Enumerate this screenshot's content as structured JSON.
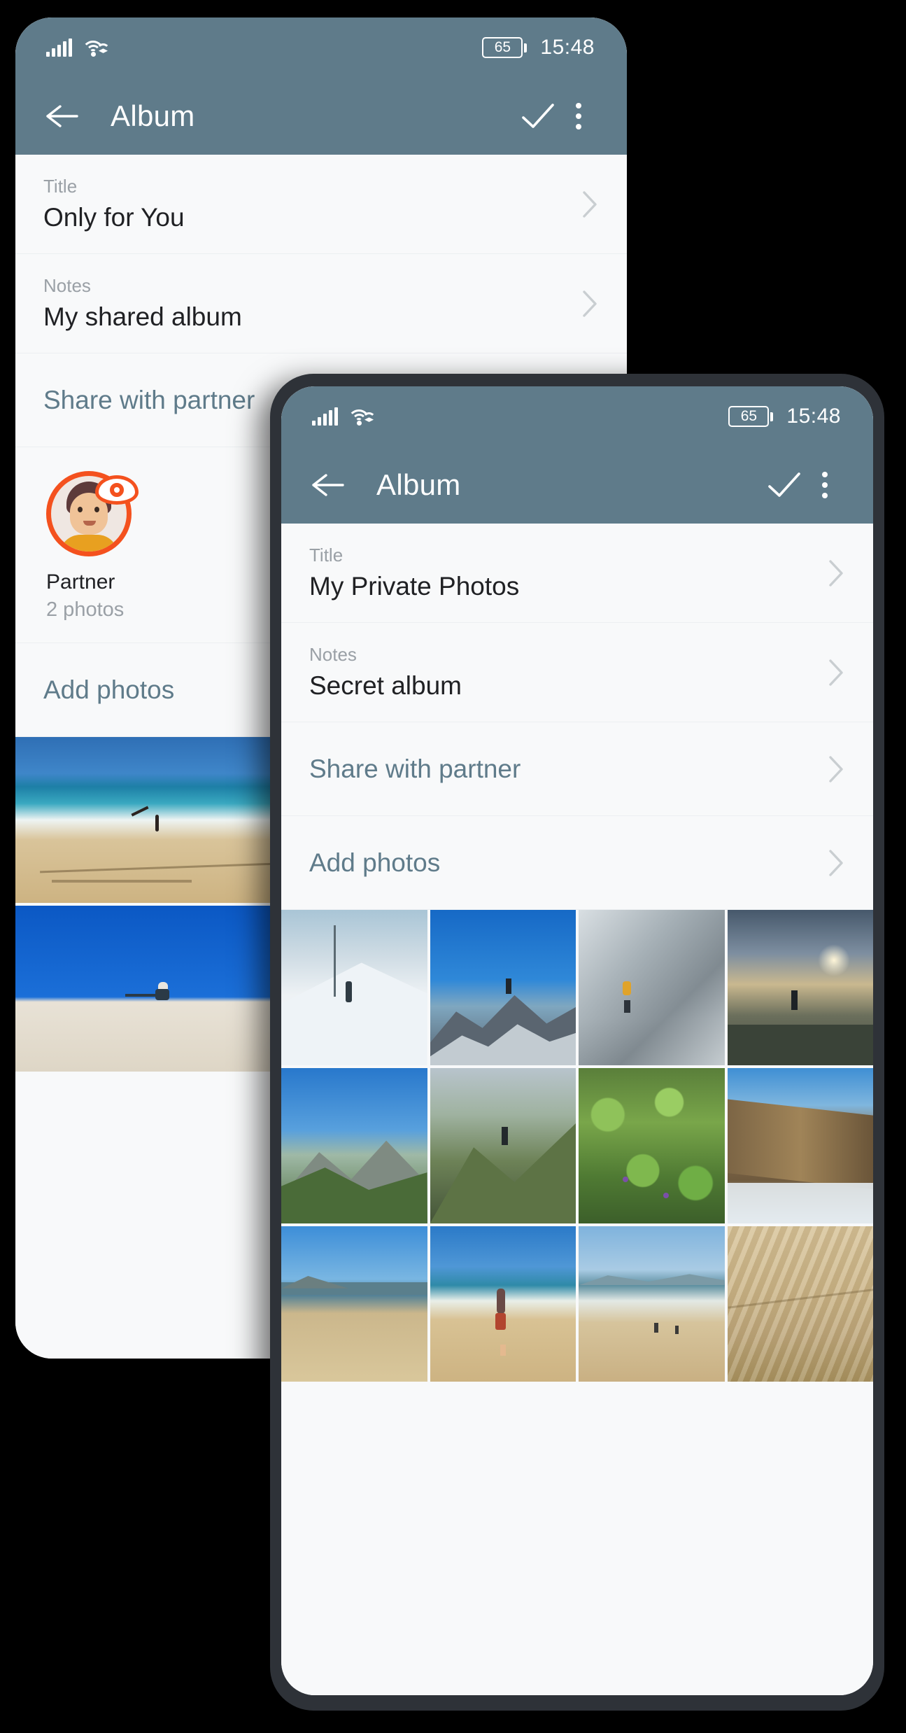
{
  "status_bar": {
    "battery_level": "65",
    "time": "15:48",
    "signal_icon": "cellular-signal-icon",
    "wifi_icon": "wifi-icon",
    "battery_icon": "battery-icon"
  },
  "app_bar": {
    "back_icon": "back-arrow-icon",
    "title": "Album",
    "confirm_icon": "check-icon",
    "overflow_icon": "kebab-menu-icon"
  },
  "phone_back": {
    "rows": [
      {
        "label": "Title",
        "value": "Only for You",
        "chevron": "chevron-right-icon"
      },
      {
        "label": "Notes",
        "value": "My shared album",
        "chevron": "chevron-right-icon"
      }
    ],
    "share_row": {
      "value": "Share with partner",
      "chevron": "chevron-right-icon"
    },
    "partner": {
      "name": "Partner",
      "photo_count": "2 photos",
      "avatar_icon": "partner-avatar-icon",
      "badge_icon": "eye-icon"
    },
    "add_row": {
      "value": "Add photos",
      "chevron": "chevron-right-icon"
    },
    "photos": [
      {
        "name": "beach-2022-heart",
        "selected": false
      },
      {
        "name": "woman-walking-beach",
        "selected": false
      },
      {
        "name": "person-sitting-sand",
        "selected": false
      },
      {
        "name": "woman-black-dress-mountain",
        "selected": true
      }
    ]
  },
  "phone_front": {
    "rows": [
      {
        "label": "Title",
        "value": "My Private Photos",
        "chevron": "chevron-right-icon"
      },
      {
        "label": "Notes",
        "value": "Secret album",
        "chevron": "chevron-right-icon"
      }
    ],
    "share_row": {
      "value": "Share with partner",
      "chevron": "chevron-right-icon"
    },
    "add_row": {
      "value": "Add photos",
      "chevron": "chevron-right-icon"
    },
    "photos": [
      {
        "name": "ski-slope-snow",
        "selected": false
      },
      {
        "name": "mountain-summit-blue-sky",
        "selected": false
      },
      {
        "name": "climber-rocky-ridge",
        "selected": false
      },
      {
        "name": "hiker-sunset-cliff",
        "selected": false
      },
      {
        "name": "green-alpine-peak",
        "selected": false
      },
      {
        "name": "hiker-misty-slope",
        "selected": false
      },
      {
        "name": "mossy-green-rocks",
        "selected": false
      },
      {
        "name": "cliff-above-clouds",
        "selected": false
      },
      {
        "name": "beach-dune-blue-sea",
        "selected": false
      },
      {
        "name": "woman-walking-shore",
        "selected": false
      },
      {
        "name": "wide-beach-figures",
        "selected": false
      },
      {
        "name": "sand-dune-ripples",
        "selected": false
      }
    ]
  },
  "colors": {
    "app_bar": "#5f7b8a",
    "selection": "#f4511e",
    "background": "#f8f9fa",
    "label_text": "#9aa0a6",
    "value_text": "#202124",
    "link_text": "#5f7b8a",
    "phone_frame": "#2e3238"
  }
}
